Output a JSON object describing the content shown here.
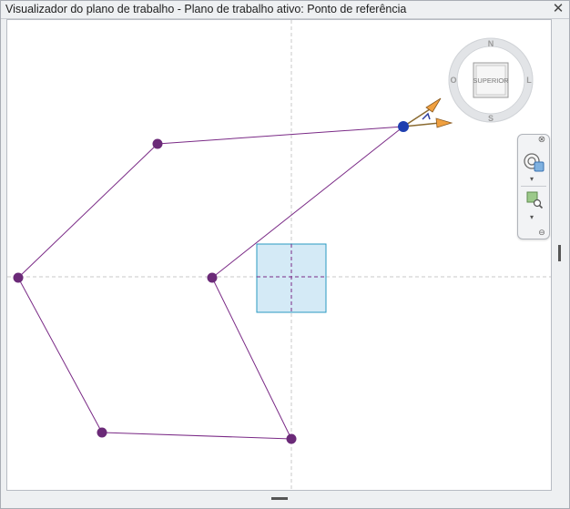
{
  "window": {
    "title": "Visualizador do plano de trabalho - Plano de trabalho ativo: Ponto de referência",
    "close_glyph": "✕"
  },
  "viewcube": {
    "face_label": "SUPERIOR",
    "north": "N",
    "south": "S",
    "east": "L",
    "west": "O"
  },
  "navigation_bar": {
    "close_glyph": "⊗",
    "menu_glyph": "⊖",
    "dropdown_glyph": "▾",
    "tools": [
      {
        "name": "steering-wheel",
        "icon": "steering-wheel-icon"
      },
      {
        "name": "zoom-region",
        "icon": "zoom-region-icon"
      }
    ]
  },
  "colors": {
    "profile_line": "#7a2a86",
    "profile_vertex": "#6b2a78",
    "active_point": "#1f3fb0",
    "reference_plane_fill": "#d4eaf6",
    "reference_plane_stroke": "#2a9ac2",
    "gizmo_arrow": "#f0a040",
    "guide_line": "#c8c8c8"
  }
}
